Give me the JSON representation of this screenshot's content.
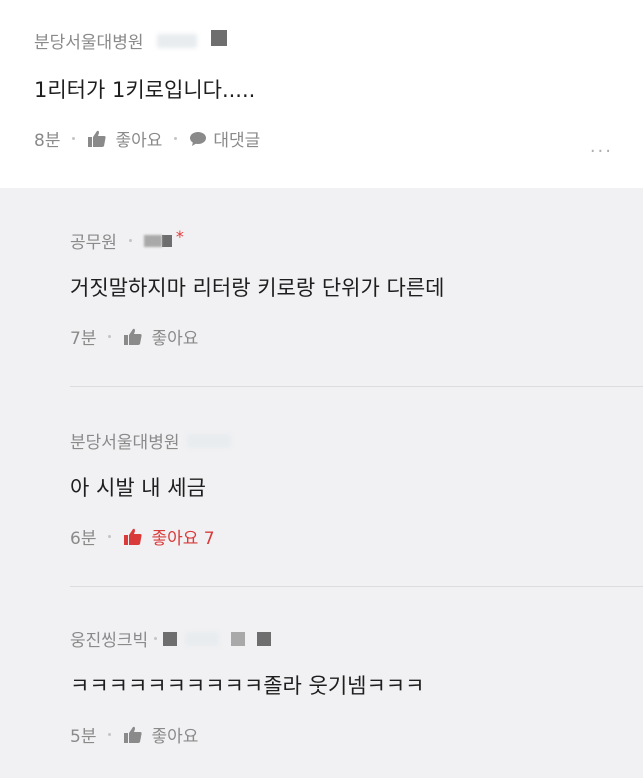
{
  "top_comment": {
    "author": "분당서울대병원",
    "text": "1리터가 1키로입니다.....",
    "time": "8분",
    "like_label": "좋아요",
    "reply_label": "대댓글",
    "more_label": "..."
  },
  "replies": [
    {
      "author": "공무원",
      "text": "거짓말하지마 리터랑 키로랑 단위가 다른데",
      "time": "7분",
      "like_label": "좋아요",
      "star": "*"
    },
    {
      "author": "분당서울대병원",
      "text": "아 시발 내 세금",
      "time": "6분",
      "like_label": "좋아요 7"
    },
    {
      "author": "웅진씽크빅",
      "text": "ㅋㅋㅋㅋㅋㅋㅋㅋㅋㅋ졸라 웃기넴ㅋㅋㅋ",
      "time": "5분",
      "like_label": "좋아요"
    }
  ],
  "colors": {
    "liked": "#d93a3a",
    "muted": "#8a8a8a",
    "reply_bg": "#f1f1f3"
  },
  "icons": {
    "like": "thumbs-up-icon",
    "reply": "speech-bubble-icon",
    "more": "more-dots-icon"
  }
}
